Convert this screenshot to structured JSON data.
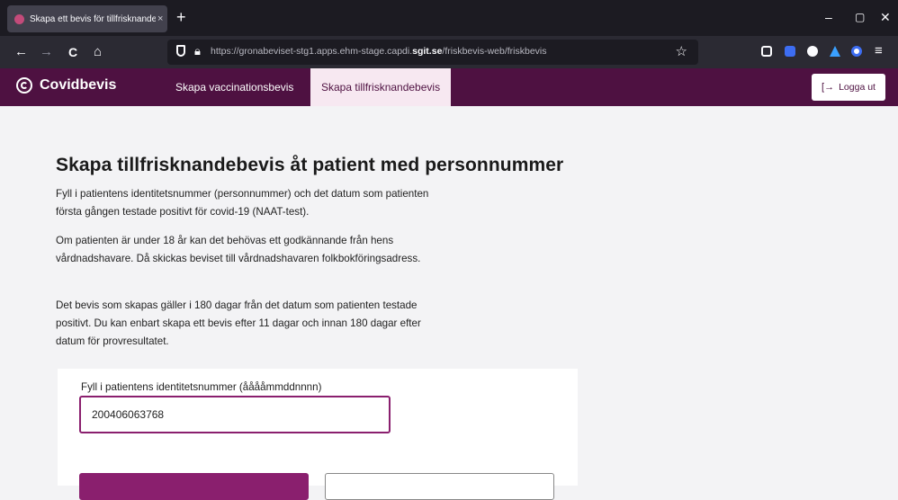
{
  "browser": {
    "tab_title": "Skapa ett bevis för tillfrisknande",
    "tab_close": "×",
    "new_tab": "+",
    "url_prefix": "https://gronabeviset-stg1.apps.ehm-stage.capdi.",
    "url_domain": "sgit.se",
    "url_path": "/friskbevis-web/friskbevis",
    "window_buttons": {
      "minimize": "–",
      "maximize": "▢",
      "close": "✕"
    },
    "nav_icons": {
      "back": "←",
      "forward": "→",
      "reload": "C",
      "home": "⌂",
      "star": "☆",
      "menu": "≡"
    }
  },
  "app": {
    "brand": "Covidbevis",
    "nav": [
      {
        "label": "Skapa vaccinationsbevis"
      },
      {
        "label": "Skapa tillfrisknandebevis"
      }
    ],
    "logout_label": "Logga ut",
    "logout_icon": "[→"
  },
  "main": {
    "title": "Skapa tillfrisknandebevis åt patient med personnummer",
    "paragraphs": [
      "Fyll i patientens identitetsnummer (personnummer) och det datum som patienten första gången testade positivt för covid-19 (NAAT-test).",
      "Om patienten är under 18 år kan det behövas ett godkännande från hens vårdnadshavare. Då skickas beviset till vårdnadshavaren folkbokföringsadress.",
      "Det bevis som skapas gäller i 180 dagar från det datum som patienten testade positivt. Du kan enbart skapa ett bevis efter 11 dagar och innan 180 dagar efter datum för provresultatet."
    ],
    "form": {
      "id_label": "Fyll i patientens identitetsnummer (ååååmmddnnnn)",
      "id_value": "200406063768"
    }
  },
  "colors": {
    "brand": "#4e1141",
    "accent": "#8a1f6e",
    "active_tab_bg": "#f7e8f1",
    "page_bg": "#f3f3f5"
  }
}
